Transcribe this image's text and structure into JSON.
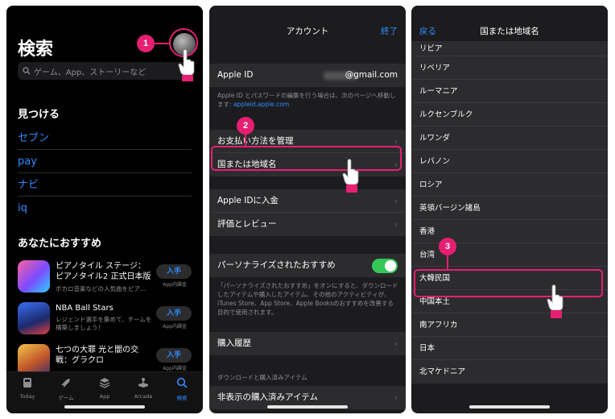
{
  "panel1": {
    "title": "検索",
    "search_placeholder": "ゲーム、App、ストーリーなど",
    "discover_heading": "見つける",
    "discover_items": [
      "セブン",
      "pay",
      "ナビ",
      "iq"
    ],
    "recommend_heading": "あなたにおすすめ",
    "apps": [
      {
        "name": "ピアノタイル ステージ：ピアノタイル2 正式日本版",
        "sub": "ボカロ音楽などの人気曲をピア…",
        "get": "入手",
        "iap": "App内課金"
      },
      {
        "name": "NBA Ball Stars",
        "sub": "レジェンド選手を集めて、チームを構築しましょう！",
        "get": "入手",
        "iap": "App内課金"
      },
      {
        "name": "七つの大罪 光と闇の交戦：グラクロ",
        "sub": "",
        "get": "入手",
        "iap": "App内課金"
      }
    ],
    "tabs": [
      {
        "label": "Today",
        "icon": "today-icon"
      },
      {
        "label": "ゲーム",
        "icon": "rocket-icon"
      },
      {
        "label": "App",
        "icon": "layers-icon"
      },
      {
        "label": "Arcade",
        "icon": "arcade-icon"
      },
      {
        "label": "検索",
        "icon": "search-icon"
      }
    ],
    "active_tab": "検索"
  },
  "panel2": {
    "title": "アカウント",
    "done": "終了",
    "apple_id_label": "Apple ID",
    "apple_id_value": "@gmail.com",
    "apple_id_note": "Apple ID とパスワードの編集を行う場合は、次のページへ移動します: ",
    "apple_id_link": "appleid.apple.com",
    "rows_a": [
      "お支払い方法を管理",
      "国または地域名"
    ],
    "rows_b": [
      "Apple IDに入金",
      "評価とレビュー"
    ],
    "personalize_label": "パーソナライズされたおすすめ",
    "personalize_on": true,
    "personalize_note": "「パーソナライズされたおすすめ」をオンにすると、ダウンロードしたアイテムや購入したアイテム、その他のアクティビティが、iTunes Store、App Store、Apple Booksのおすすめを改善する目的で使用されます。",
    "purchase_history": "購入履歴",
    "downloads_caption": "ダウンロードと購入済みアイテム",
    "hidden_purchases": "非表示の購入済みアイテム"
  },
  "panel3": {
    "back": "戻る",
    "title": "国または地域名",
    "countries": [
      "リビア",
      "リベリア",
      "ルーマニア",
      "ルクセンブルク",
      "ルワンダ",
      "レバノン",
      "ロシア",
      "英領バージン諸島",
      "香港",
      "台湾",
      "大韓民国",
      "中国本土",
      "南アフリカ",
      "日本",
      "北マケドニア"
    ],
    "selected": "大韓民国"
  },
  "steps": [
    "1",
    "2",
    "3"
  ],
  "colors": {
    "accent": "#e61f73",
    "link": "#2f8cff",
    "toggle_on": "#34c759"
  }
}
